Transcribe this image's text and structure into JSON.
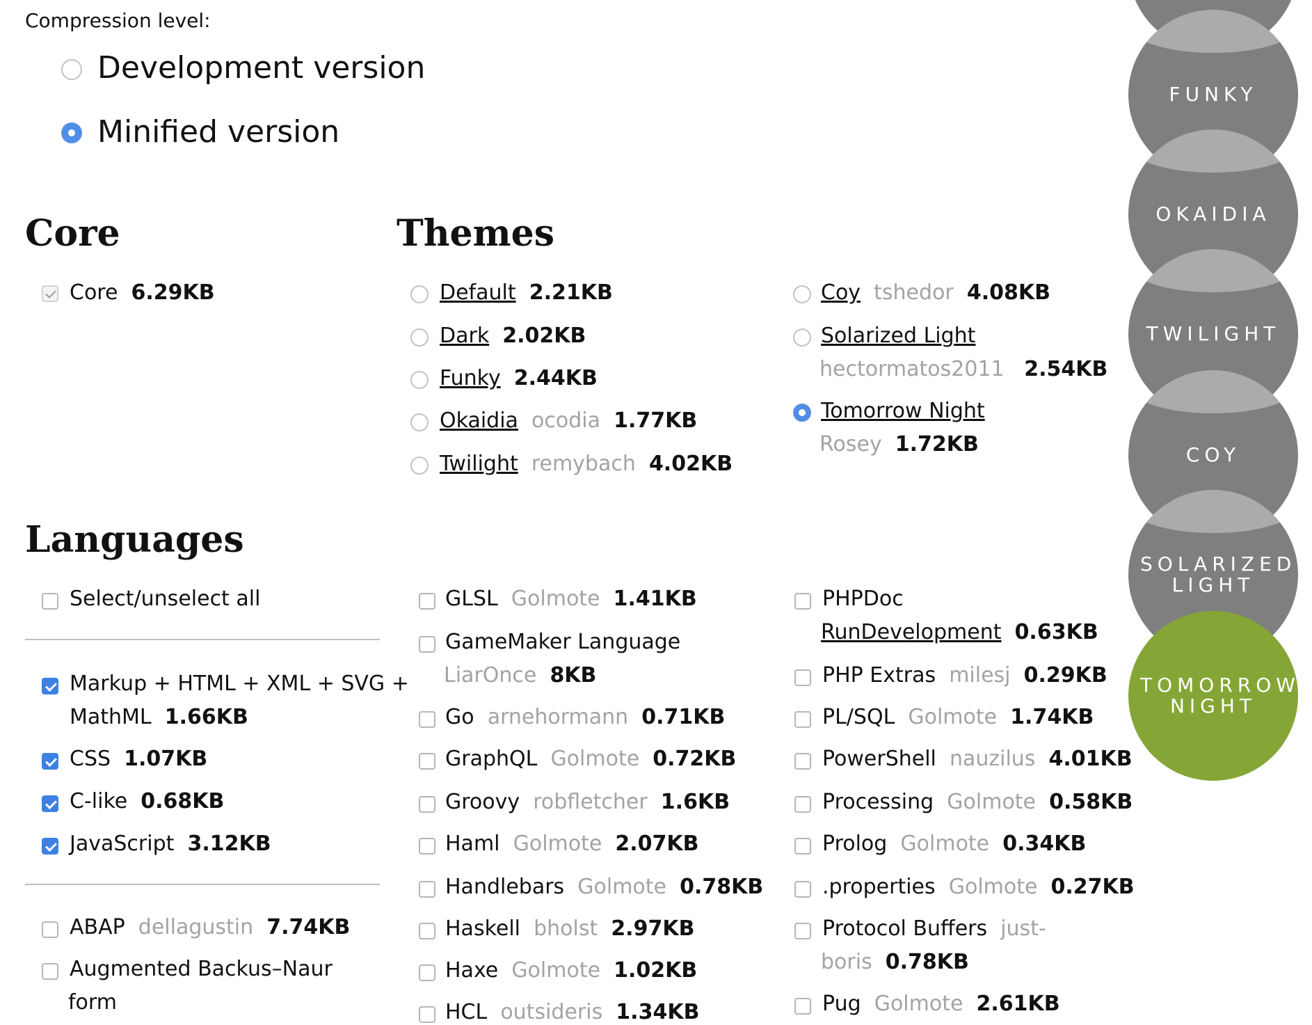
{
  "compression": {
    "label": "Compression level:",
    "options": [
      "Development version",
      "Minified version"
    ],
    "selected": "Minified version"
  },
  "core": {
    "heading": "Core",
    "item": {
      "name": "Core",
      "size": "6.29KB"
    }
  },
  "themes": {
    "heading": "Themes",
    "col1": [
      {
        "name": "Default",
        "author": "",
        "size": "2.21KB"
      },
      {
        "name": "Dark",
        "author": "",
        "size": "2.02KB"
      },
      {
        "name": "Funky",
        "author": "",
        "size": "2.44KB"
      },
      {
        "name": "Okaidia",
        "author": "ocodia",
        "size": "1.77KB"
      },
      {
        "name": "Twilight",
        "author": "remybach",
        "size": "4.02KB"
      }
    ],
    "col2": [
      {
        "name": "Coy",
        "author": "tshedor",
        "size": "4.08KB"
      },
      {
        "name": "Solarized Light",
        "author": "hectormatos2011",
        "size": "2.54KB"
      },
      {
        "name": "Tomorrow Night",
        "author": "Rosey",
        "size": "1.72KB"
      }
    ],
    "selected": "Tomorrow Night"
  },
  "languages": {
    "heading": "Languages",
    "select_all": "Select/unselect all",
    "checked": [
      {
        "line1": "Markup + HTML + XML + SVG +",
        "line2": "MathML",
        "size": "1.66KB"
      },
      {
        "name": "CSS",
        "size": "1.07KB"
      },
      {
        "name": "C-like",
        "size": "0.68KB"
      },
      {
        "name": "JavaScript",
        "size": "3.12KB"
      }
    ],
    "col1_rest": [
      {
        "name": "ABAP",
        "author": "dellagustin",
        "size": "7.74KB"
      },
      {
        "line1": "Augmented Backus–Naur",
        "line2": "form"
      }
    ],
    "col2": [
      {
        "name": "GLSL",
        "author": "Golmote",
        "size": "1.41KB"
      },
      {
        "name": "GameMaker Language",
        "author": "LiarOnce",
        "size": "8KB"
      },
      {
        "name": "Go",
        "author": "arnehormann",
        "size": "0.71KB"
      },
      {
        "name": "GraphQL",
        "author": "Golmote",
        "size": "0.72KB"
      },
      {
        "name": "Groovy",
        "author": "robfletcher",
        "size": "1.6KB"
      },
      {
        "name": "Haml",
        "author": "Golmote",
        "size": "2.07KB"
      },
      {
        "name": "Handlebars",
        "author": "Golmote",
        "size": "0.78KB"
      },
      {
        "name": "Haskell",
        "author": "bholst",
        "size": "2.97KB"
      },
      {
        "name": "Haxe",
        "author": "Golmote",
        "size": "1.02KB"
      },
      {
        "name": "HCL",
        "author": "outsideris",
        "size": "1.34KB"
      }
    ],
    "col3": [
      {
        "name": "PHPDoc",
        "author": "RunDevelopment",
        "size": "0.63KB"
      },
      {
        "name": "PHP Extras",
        "author": "milesj",
        "size": "0.29KB"
      },
      {
        "name": "PL/SQL",
        "author": "Golmote",
        "size": "1.74KB"
      },
      {
        "name": "PowerShell",
        "author": "nauzilus",
        "size": "4.01KB"
      },
      {
        "name": "Processing",
        "author": "Golmote",
        "size": "0.58KB"
      },
      {
        "name": "Prolog",
        "author": "Golmote",
        "size": "0.34KB"
      },
      {
        "name": ".properties",
        "author": "Golmote",
        "size": "0.27KB"
      },
      {
        "name": "Protocol Buffers",
        "author_line1": "just-",
        "author_line2": "boris",
        "size": "0.78KB"
      },
      {
        "name": "Pug",
        "author": "Golmote",
        "size": "2.61KB"
      }
    ]
  },
  "theme_switcher": {
    "items": [
      "FUNKY",
      "OKAIDIA",
      "TWILIGHT",
      "COY",
      "SOLARIZED LIGHT",
      "TOMORROW NIGHT"
    ],
    "active": "TOMORROW NIGHT",
    "colors": {
      "inactive": "#7f7f7f",
      "active": "#85a636",
      "stripe": "#e58a78"
    }
  }
}
